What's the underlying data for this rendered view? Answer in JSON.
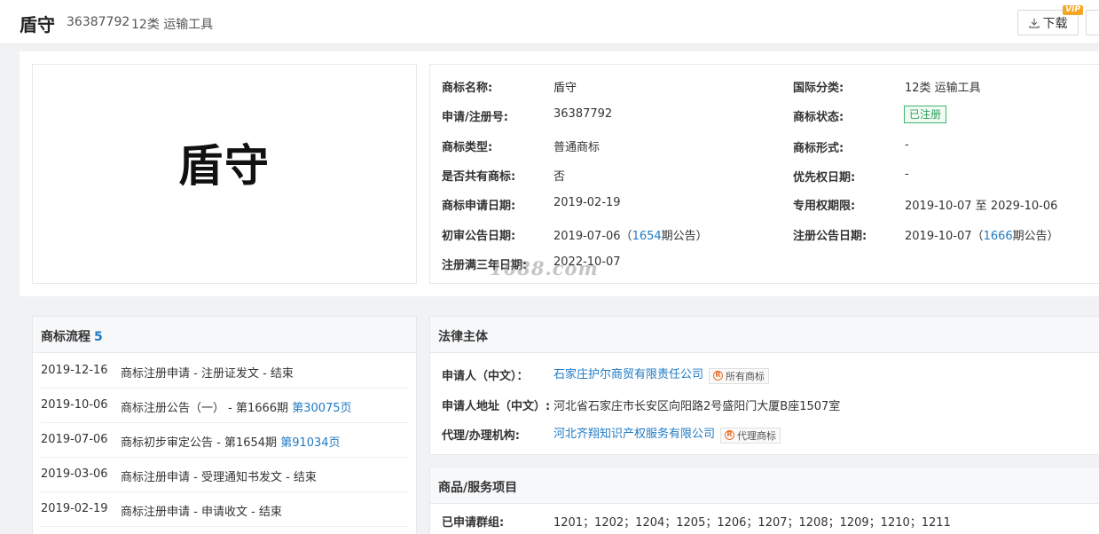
{
  "header": {
    "title": "盾守",
    "reg_no": "36387792",
    "class_text": "12类 运输工具",
    "download_label": "下载",
    "vip_badge": "VIP"
  },
  "logo_text": "盾守",
  "watermark": "1688.com",
  "info": {
    "name_label": "商标名称:",
    "name": "盾守",
    "intl_class_label": "国际分类:",
    "intl_class": "12类 运输工具",
    "reg_no_label": "申请/注册号:",
    "reg_no": "36387792",
    "status_label": "商标状态:",
    "status": "已注册",
    "type_label": "商标类型:",
    "type": "普通商标",
    "form_label": "商标形式:",
    "form": "-",
    "shared_label": "是否共有商标:",
    "shared": "否",
    "priority_label": "优先权日期:",
    "priority": "-",
    "apply_date_label": "商标申请日期:",
    "apply_date": "2019-02-19",
    "exclusive_label": "专用权期限:",
    "exclusive": "2019-10-07 至 2029-10-06",
    "prelim_label": "初审公告日期:",
    "prelim_date": "2019-07-06（",
    "prelim_issue": "1654",
    "prelim_suffix": "期公告）",
    "regpub_label": "注册公告日期:",
    "regpub_date": "2019-10-07（",
    "regpub_issue": "1666",
    "regpub_suffix": "期公告）",
    "three_year_label": "注册满三年日期:",
    "three_year": "2022-10-07"
  },
  "flow": {
    "title": "商标流程",
    "count": "5",
    "rows": [
      {
        "date": "2019-12-16",
        "desc": "商标注册申请 - 注册证发文 - 结束",
        "link": ""
      },
      {
        "date": "2019-10-06",
        "desc": "商标注册公告（一） - 第1666期 ",
        "link": "第30075页"
      },
      {
        "date": "2019-07-06",
        "desc": "商标初步审定公告 - 第1654期 ",
        "link": "第91034页"
      },
      {
        "date": "2019-03-06",
        "desc": "商标注册申请 - 受理通知书发文 - 结束",
        "link": ""
      },
      {
        "date": "2019-02-19",
        "desc": "商标注册申请 - 申请收文 - 结束",
        "link": ""
      }
    ]
  },
  "legal": {
    "title": "法律主体",
    "applicant_label": "申请人（中文）：",
    "applicant": "石家庄护尔商贸有限责任公司",
    "applicant_tag": "所有商标",
    "address_label": "申请人地址（中文）:",
    "address": "河北省石家庄市长安区向阳路2号盛阳门大厦B座1507室",
    "agent_label": "代理/办理机构:",
    "agent": "河北齐翔知识产权服务有限公司",
    "agent_tag": "代理商标",
    "tag_icon": "R"
  },
  "goods": {
    "title": "商品/服务项目",
    "group_label": "已申请群组:",
    "groups": "1201；1202；1204；1205；1206；1207；1208；1209；1210；1211"
  }
}
